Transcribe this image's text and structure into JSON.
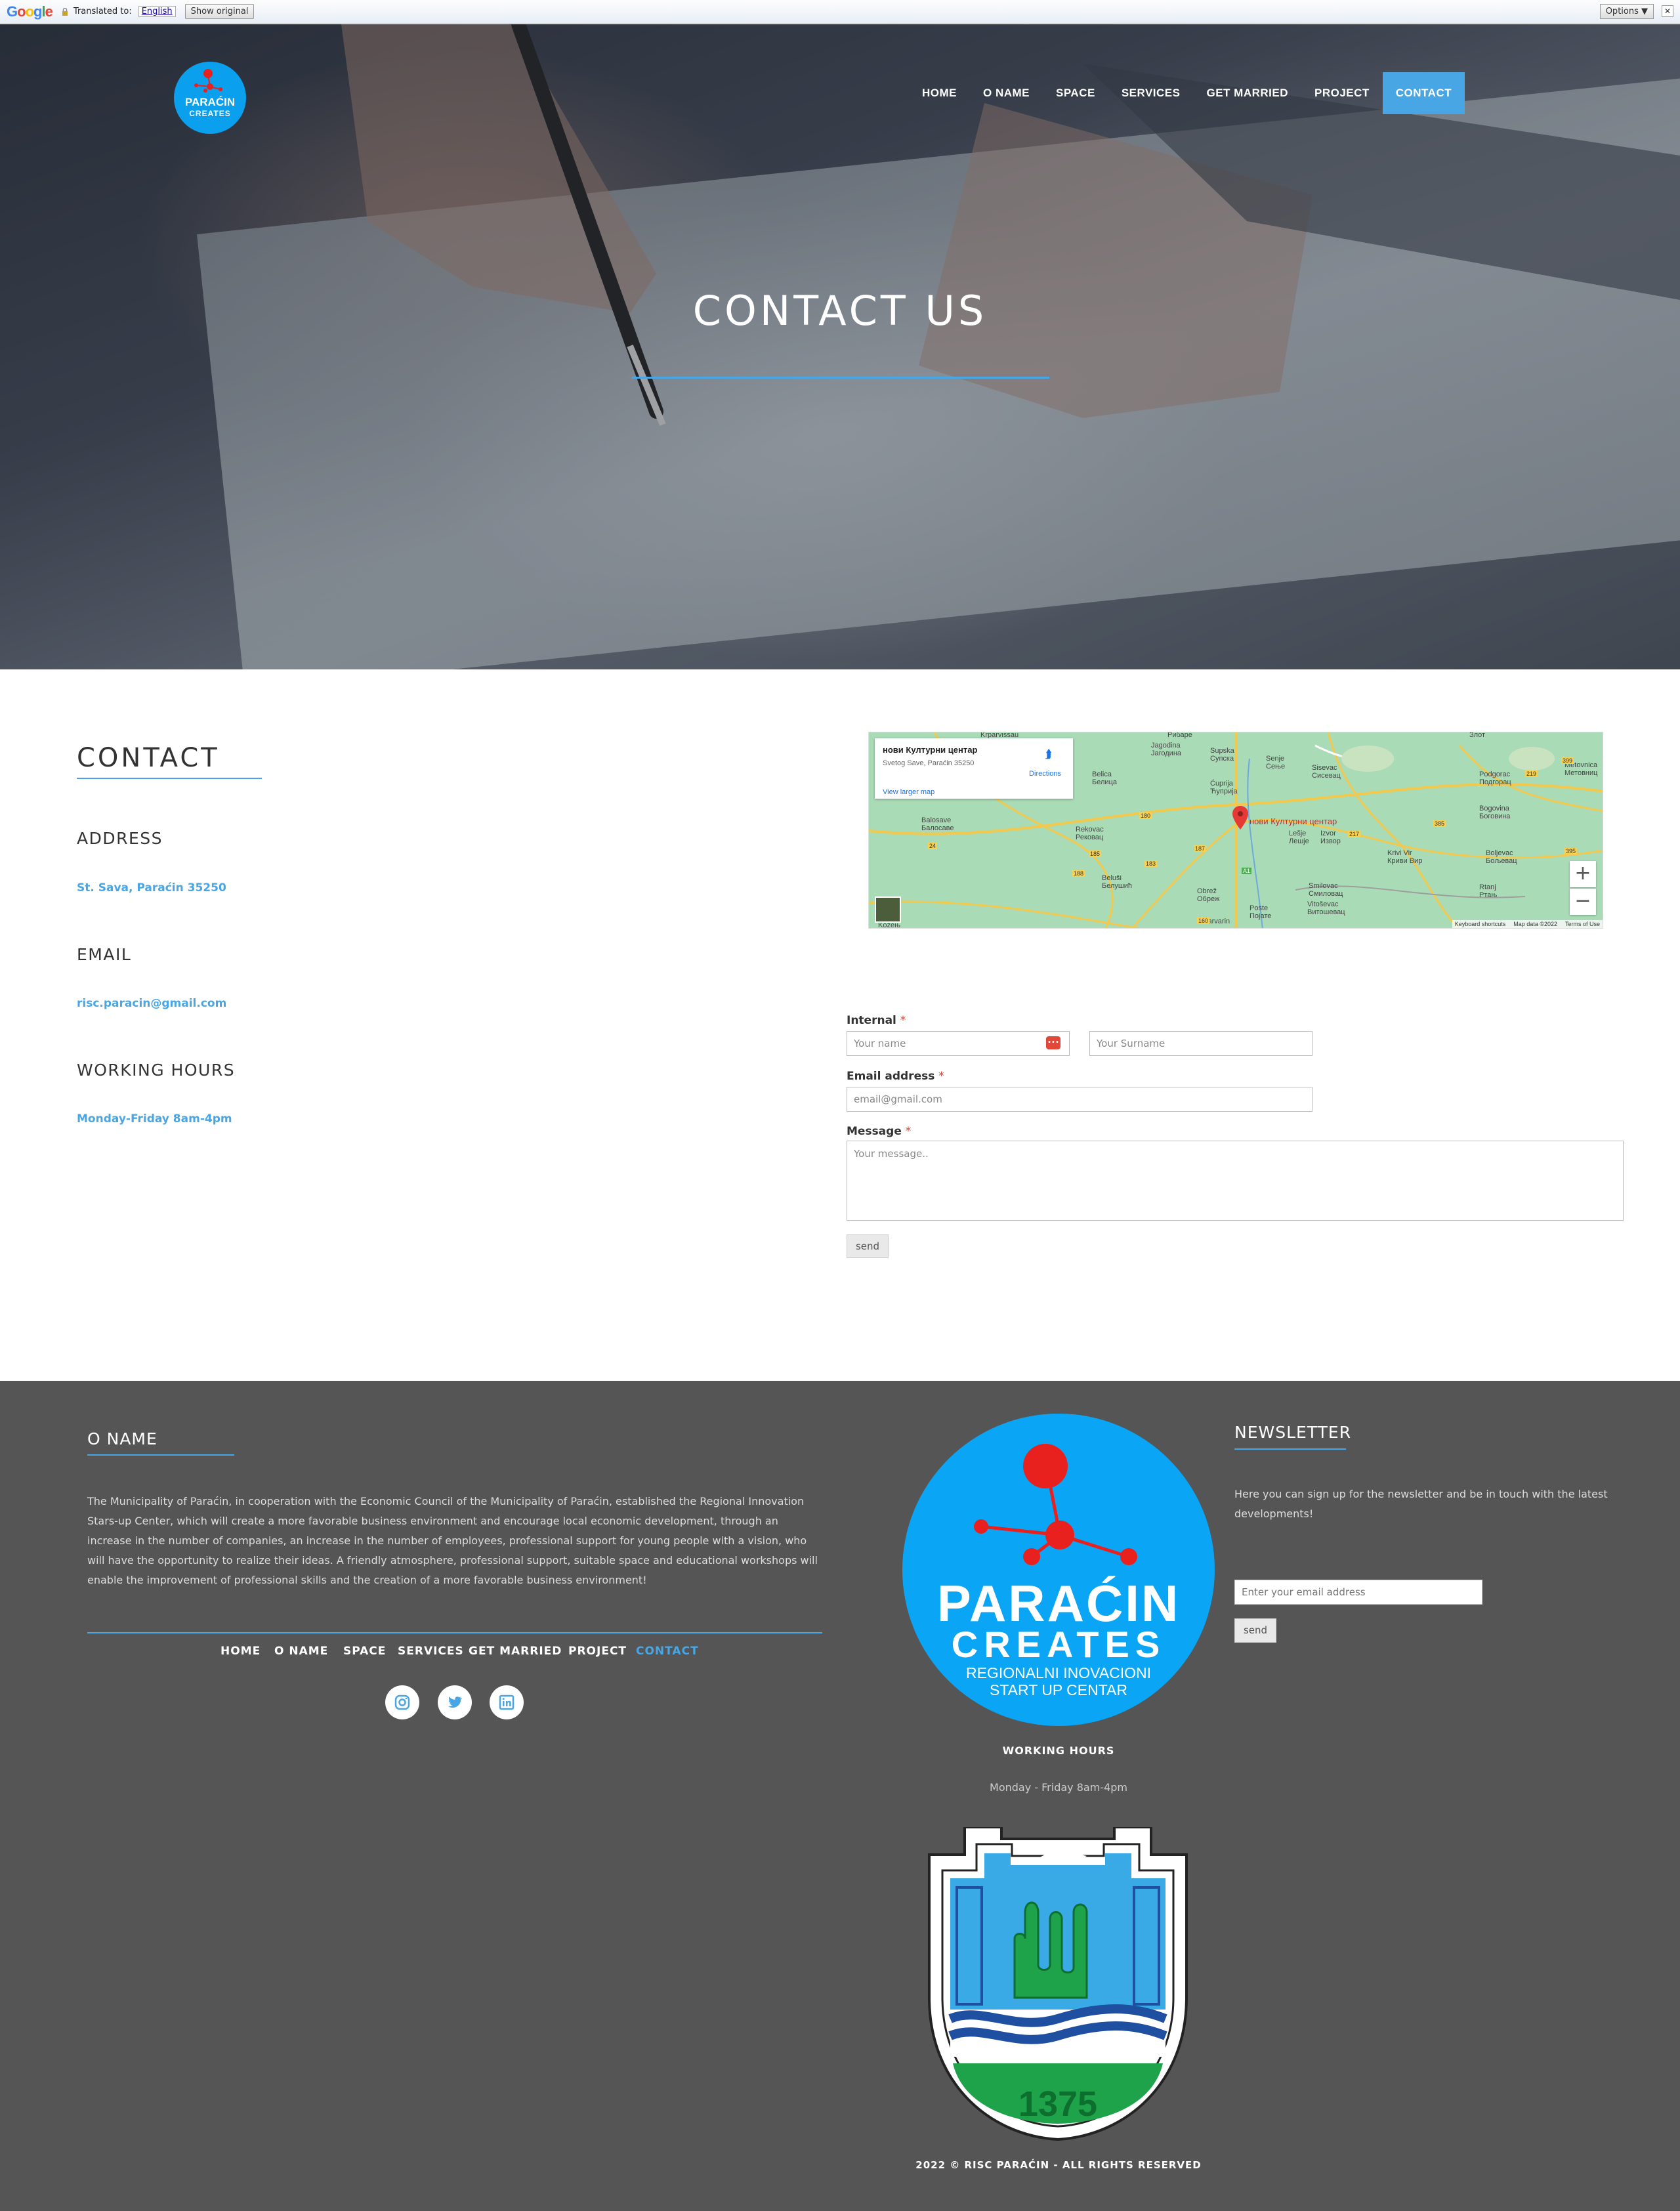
{
  "translate_bar": {
    "logo": "Google",
    "label": "Translated to:",
    "language": "English",
    "show_original": "Show original",
    "options": "Options ▼",
    "close": "✕"
  },
  "header": {
    "logo": {
      "line1": "PARAĆIN",
      "line2": "CREATES",
      "line3": "REGIONALNI INOVACIONI START UP CENTAR"
    },
    "nav": [
      "HOME",
      "O NAME",
      "SPACE",
      "SERVICES",
      "GET MARRIED",
      "PROJECT",
      "CONTACT"
    ],
    "active": "CONTACT"
  },
  "hero": {
    "title": "CONTACT US"
  },
  "contact": {
    "title": "CONTACT",
    "address_label": "ADDRESS",
    "address": "St. Sava, Paraćin 35250",
    "email_label": "EMAIL",
    "email": "risc.paracin@gmail.com",
    "hours_label": "WORKING HOURS",
    "hours": "Monday-Friday 8am-4pm"
  },
  "map": {
    "place": "нови Културни центар",
    "address": "Svetog Save, Paraćin 35250",
    "larger": "View larger map",
    "directions": "Directions",
    "marker_label": "нови Културни центар",
    "footer": [
      "Keyboard shortcuts",
      "Map data ©2022",
      "Terms of Use"
    ],
    "towns": [
      "Krparvissau",
      "Рибаре",
      "Jagodina Јагодина",
      "Supska Супска",
      "Senje Сење",
      "Sisevac Сисевац",
      "Злот",
      "Belica Белица",
      "Ćuprija Ћуприја",
      "Podgorac Подгорац",
      "Metovnica Метовниц",
      "Balosave Балосаве",
      "Rekovac Рековац",
      "Lešje Лешје",
      "Izvor Извор",
      "Bogovina Боговина",
      "Beluši Белушић",
      "Obrež Обреж",
      "Krivi Vir Криви Вир",
      "Boljevac Бољевац",
      "Smilovac Смиловац",
      "Vitoševac Витошевац",
      "Poste Поjате",
      "Varvarin",
      "Rtanj Ртањ",
      "Kožeњ"
    ],
    "roads": [
      "180",
      "185",
      "183",
      "187",
      "188",
      "385",
      "24",
      "217",
      "160",
      "A1",
      "219",
      "395",
      "399"
    ]
  },
  "form": {
    "name_label": "Internal",
    "name_placeholder": "Your name",
    "surname_placeholder": "Your Surname",
    "email_label": "Email address",
    "email_placeholder": "email@gmail.com",
    "message_label": "Message",
    "message_placeholder": "Your message..",
    "required": "*",
    "send": "send",
    "badge": "•••"
  },
  "footer": {
    "about_title": "O NAME",
    "about_text": "The Municipality of Paraćin, in cooperation with the Economic Council of the Municipality of Paraćin, established the Regional Innovation Stars-up Center, which will create a more favorable business environment and encourage local economic development, through an increase in the number of companies, an increase in the number of employees, professional support for young people with a vision, who will have the opportunity to realize their ideas. A friendly atmosphere, professional support, suitable space and educational workshops will enable the improvement of professional skills and the creation of a more favorable business environment!",
    "nav": [
      "HOME",
      "O NAME",
      "SPACE",
      "SERVICES",
      "GET MARRIED",
      "PROJECT",
      "CONTACT"
    ],
    "social": [
      "instagram-icon",
      "twitter-icon",
      "linkedin-icon"
    ],
    "logo": {
      "line1": "PARAĆIN",
      "line2": "CREATES",
      "line3": "REGIONALNI INOVACIONI",
      "line4": "START UP CENTAR"
    },
    "hours_title": "WORKING HOURS",
    "hours": "Monday - Friday 8am-4pm",
    "crest_year": "1375",
    "copyright": "2022 © RISC PARAĆIN - ALL RIGHTS RESERVED",
    "newsletter_title": "NEWSLETTER",
    "newsletter_text": "Here you can sign up for the newsletter and be in touch with the latest developments!",
    "newsletter_placeholder": "Enter your email address",
    "newsletter_send": "send"
  },
  "colors": {
    "accent": "#48a6e4",
    "footer_bg": "#555555",
    "logo_blue": "#0aa6f5",
    "logo_red": "#e8201e"
  }
}
